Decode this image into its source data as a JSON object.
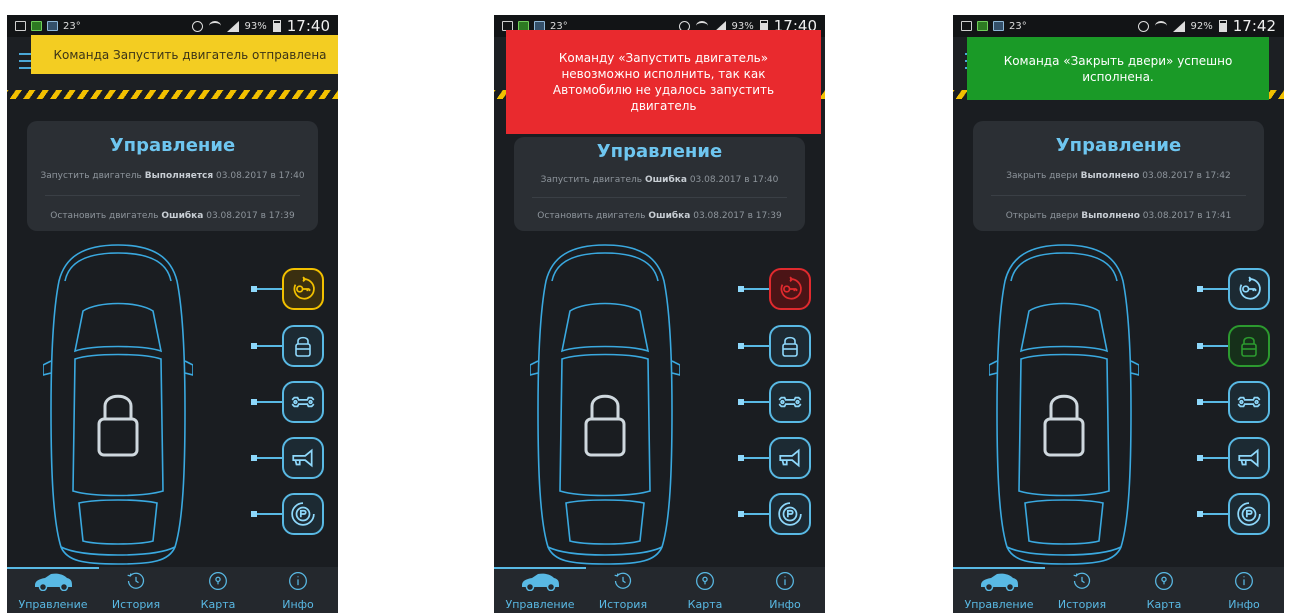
{
  "screens": [
    {
      "status": {
        "temp": "23°",
        "battery": "93%",
        "time": "17:40"
      },
      "toast": {
        "text": "Команда Запустить двигатель отправлена",
        "color": "#f3cd22"
      },
      "card": {
        "title": "Управление",
        "line1": {
          "action": "Запустить двигатель",
          "status": "Выполняется",
          "date": "03.08.2017 в 17:40"
        },
        "line2": {
          "action": "Остановить двигатель",
          "status": "Ошибка",
          "date": "03.08.2017 в 17:39"
        }
      },
      "buttons": [
        {
          "icon": "engine-start-icon",
          "state": "pending",
          "color": "#f2c000"
        },
        {
          "icon": "lock-icon",
          "state": "normal"
        },
        {
          "icon": "wrench-icon",
          "state": "normal"
        },
        {
          "icon": "horn-icon",
          "state": "normal"
        },
        {
          "icon": "parking-icon",
          "state": "normal"
        }
      ]
    },
    {
      "status": {
        "temp": "23°",
        "battery": "93%",
        "time": "17:40"
      },
      "toast": {
        "text": "Команду «Запустить двигатель» невозможно исполнить, так как Автомобилю не удалось запустить двигатель",
        "color": "#e92a2e"
      },
      "card": {
        "title": "Управление",
        "line1": {
          "action": "Запустить двигатель",
          "status": "Ошибка",
          "date": "03.08.2017 в 17:40"
        },
        "line2": {
          "action": "Остановить двигатель",
          "status": "Ошибка",
          "date": "03.08.2017 в 17:39"
        }
      },
      "buttons": [
        {
          "icon": "engine-start-icon",
          "state": "error",
          "color": "#e02a2e"
        },
        {
          "icon": "lock-icon",
          "state": "normal"
        },
        {
          "icon": "wrench-icon",
          "state": "normal"
        },
        {
          "icon": "horn-icon",
          "state": "normal"
        },
        {
          "icon": "parking-icon",
          "state": "normal"
        }
      ]
    },
    {
      "status": {
        "temp": "23°",
        "battery": "92%",
        "time": "17:42"
      },
      "toast": {
        "text": "Команда «Закрыть двери» успешно исполнена.",
        "color": "#1a9a27"
      },
      "card": {
        "title": "Управление",
        "line1": {
          "action": "Закрыть двери",
          "status": "Выполнено",
          "date": "03.08.2017 в 17:42"
        },
        "line2": {
          "action": "Открыть двери",
          "status": "Выполнено",
          "date": "03.08.2017 в 17:41"
        }
      },
      "buttons": [
        {
          "icon": "engine-start-icon",
          "state": "normal"
        },
        {
          "icon": "lock-icon",
          "state": "success",
          "color": "#2c9a2f"
        },
        {
          "icon": "wrench-icon",
          "state": "normal"
        },
        {
          "icon": "horn-icon",
          "state": "normal"
        },
        {
          "icon": "parking-icon",
          "state": "normal"
        }
      ]
    }
  ],
  "nav": {
    "items": [
      {
        "label": "Управление",
        "icon": "car-icon"
      },
      {
        "label": "История",
        "icon": "history-icon"
      },
      {
        "label": "Карта",
        "icon": "map-pin-icon"
      },
      {
        "label": "Инфо",
        "icon": "info-icon"
      }
    ]
  },
  "colors": {
    "accent": "#59b9e4",
    "title": "#6ec6f0",
    "background": "#1a1d21"
  }
}
